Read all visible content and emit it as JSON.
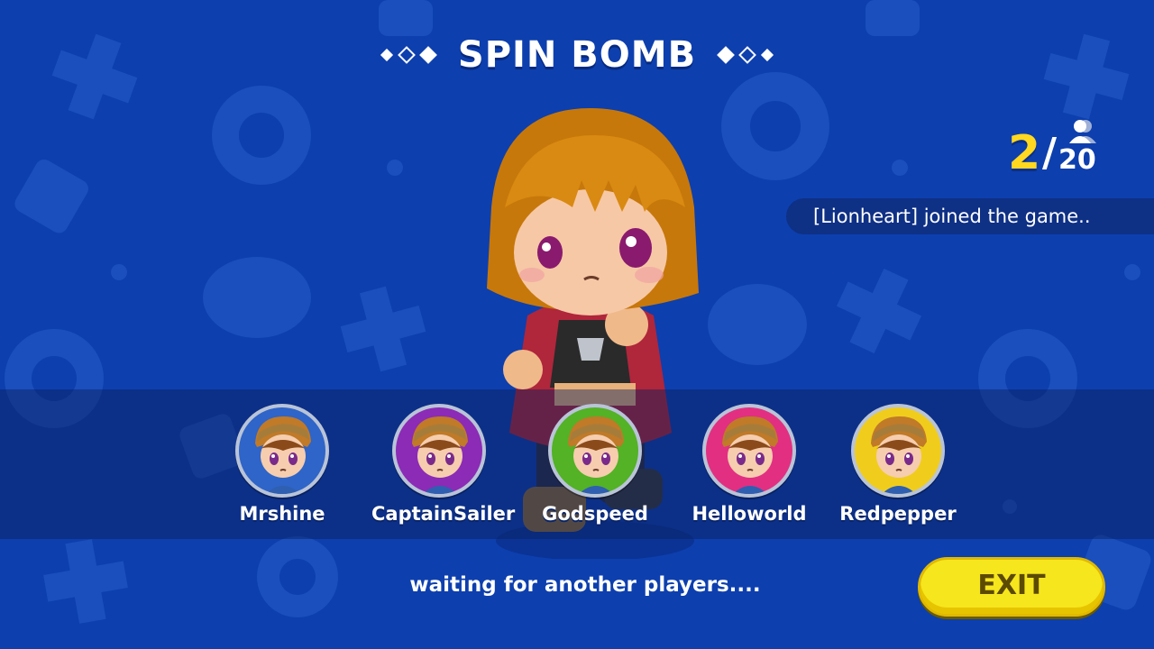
{
  "title": "SPIN BOMB",
  "player_count": {
    "current": "2",
    "separator": "/",
    "max": "20"
  },
  "notification": "[Lionheart] joined the game..",
  "players": [
    {
      "name": "Mrshine",
      "avatar_color": "#2f64c8"
    },
    {
      "name": "CaptainSailer",
      "avatar_color": "#8b2bb6"
    },
    {
      "name": "Godspeed",
      "avatar_color": "#53b225"
    },
    {
      "name": "Helloworld",
      "avatar_color": "#e22f82"
    },
    {
      "name": "Redpepper",
      "avatar_color": "#f0cd1c"
    }
  ],
  "status_text": "waiting for another players....",
  "exit_label": "EXIT",
  "icons": {
    "players_icon": "person-icon"
  },
  "colors": {
    "background": "#0d3fae",
    "accent": "#ffd81f",
    "exit_button": "#f6e61d"
  }
}
